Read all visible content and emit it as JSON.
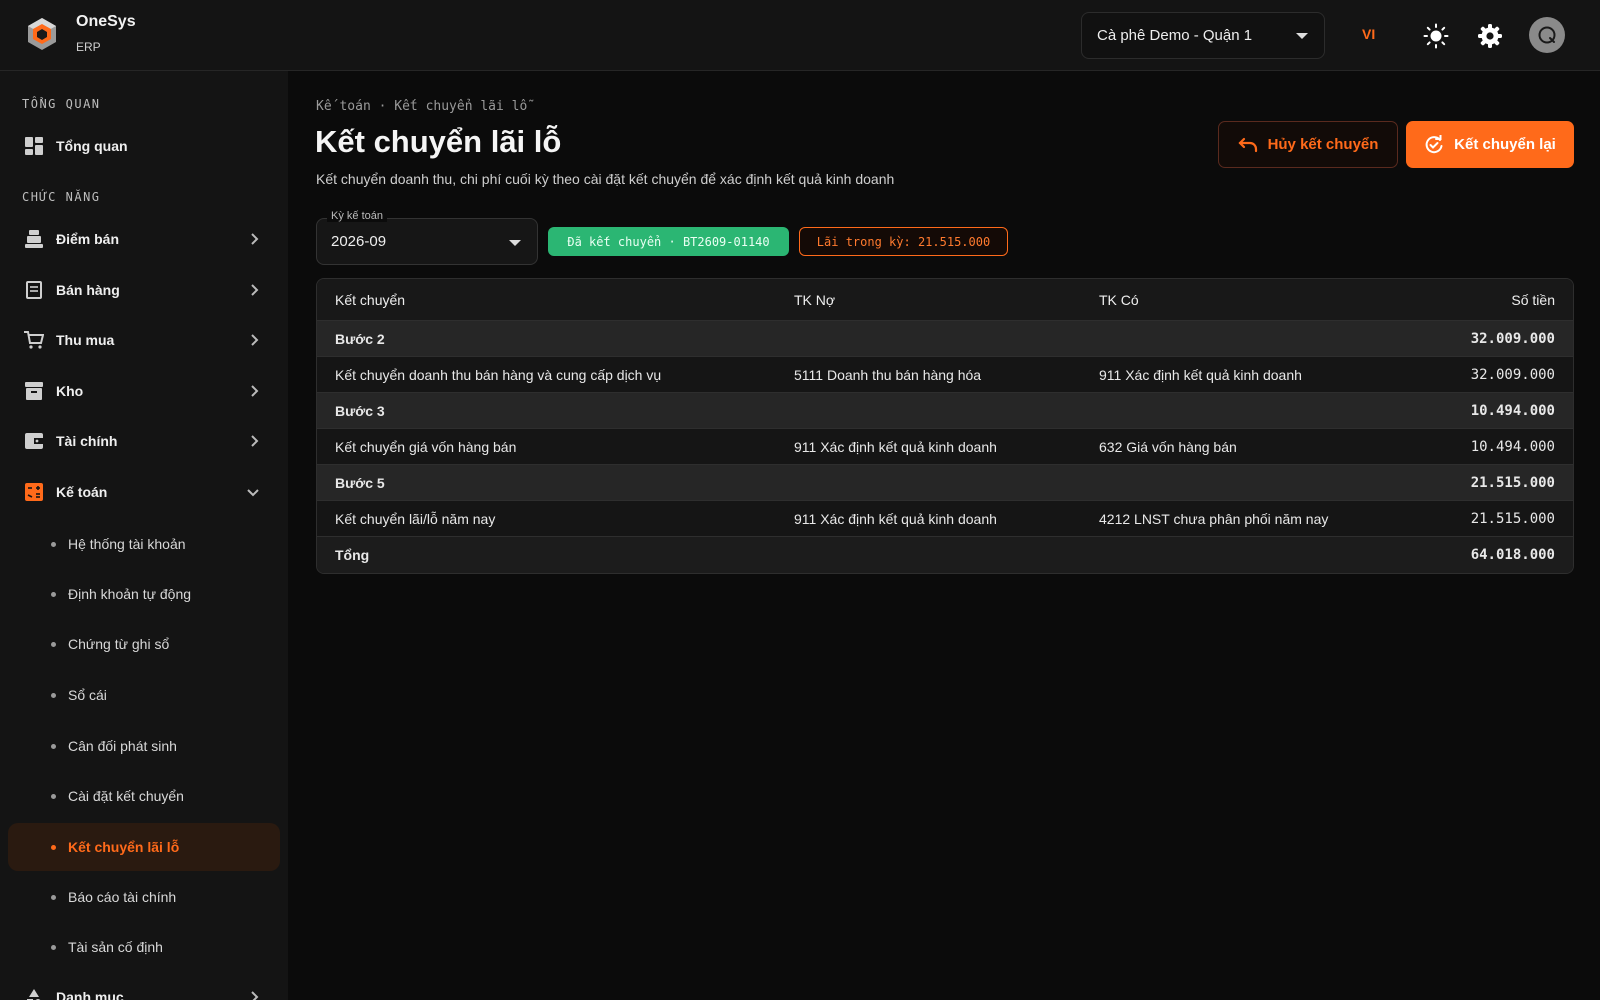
{
  "app": {
    "name": "OneSys",
    "subtitle": "ERP"
  },
  "header": {
    "branch": "Cà phê Demo - Quận 1",
    "language": "VI",
    "icons": [
      "sun-icon",
      "gear-icon",
      "avatar-icon"
    ]
  },
  "sidebar": {
    "sections": {
      "overview": "TỔNG QUAN",
      "functions": "CHỨC NĂNG"
    },
    "overview_item": "Tổng quan",
    "items": [
      {
        "label": "Điểm bán",
        "icon": "cash-register-icon"
      },
      {
        "label": "Bán hàng",
        "icon": "receipt-icon"
      },
      {
        "label": "Thu mua",
        "icon": "cart-icon"
      },
      {
        "label": "Kho",
        "icon": "archive-icon"
      },
      {
        "label": "Tài chính",
        "icon": "wallet-icon"
      },
      {
        "label": "Kế toán",
        "icon": "calculator-icon"
      }
    ],
    "sub_items": [
      "Hệ thống tài khoản",
      "Định khoản tự động",
      "Chứng từ ghi sổ",
      "Sổ cái",
      "Cân đối phát sinh",
      "Cài đặt kết chuyển",
      "Kết chuyển lãi lỗ",
      "Báo cáo tài chính",
      "Tài sản cố định"
    ],
    "active_sub": "Kết chuyển lãi lỗ",
    "last_item": "Danh mục",
    "accent": "#ff6a1a"
  },
  "main": {
    "breadcrumb": "Kế toán · Kết chuyển lãi lỗ",
    "title": "Kết chuyển lãi lỗ",
    "subtitle": "Kết chuyển doanh thu, chi phí cuối kỳ theo cài đặt kết chuyển để xác định kết quả kinh doanh",
    "buttons": {
      "cancel": "Hủy kết chuyển",
      "redo": "Kết chuyển lại"
    },
    "period": {
      "label": "Kỳ kế toán",
      "value": "2026-09"
    },
    "status_badge": "Đã kết chuyển · BT2609-01140",
    "profit_badge": "Lãi trong kỳ: 21.515.000",
    "colors": {
      "success": "#2bb673",
      "accent": "#ff6a1a"
    },
    "table": {
      "columns": [
        "Kết chuyển",
        "TK Nợ",
        "TK Có",
        "Số tiền"
      ],
      "rows": [
        {
          "type": "group",
          "c1": "Bước 2",
          "c2": "",
          "c3": "",
          "amount": "32.009.000"
        },
        {
          "type": "item",
          "c1": "Kết chuyển doanh thu bán hàng và cung cấp dịch vụ",
          "c2": "5111 Doanh thu bán hàng hóa",
          "c3": "911 Xác định kết quả kinh doanh",
          "amount": "32.009.000"
        },
        {
          "type": "group",
          "c1": "Bước 3",
          "c2": "",
          "c3": "",
          "amount": "10.494.000"
        },
        {
          "type": "item",
          "c1": "Kết chuyển giá vốn hàng bán",
          "c2": "911 Xác định kết quả kinh doanh",
          "c3": "632 Giá vốn hàng bán",
          "amount": "10.494.000"
        },
        {
          "type": "group",
          "c1": "Bước 5",
          "c2": "",
          "c3": "",
          "amount": "21.515.000"
        },
        {
          "type": "item",
          "c1": "Kết chuyển lãi/lỗ năm nay",
          "c2": "911 Xác định kết quả kinh doanh",
          "c3": "4212 LNST chưa phân phối năm nay",
          "amount": "21.515.000"
        },
        {
          "type": "total",
          "c1": "Tổng",
          "c2": "",
          "c3": "",
          "amount": "64.018.000"
        }
      ]
    }
  }
}
